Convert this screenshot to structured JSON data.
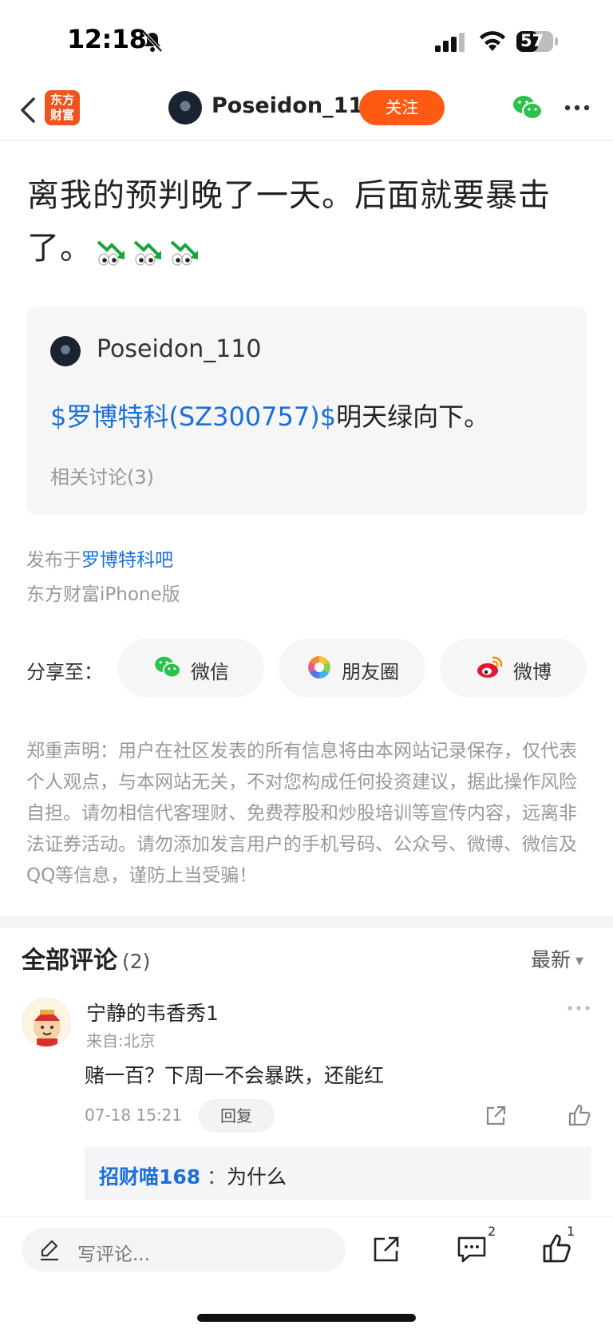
{
  "status_bar": {
    "time": "12:18",
    "battery": "57"
  },
  "nav": {
    "back_icon": "chevron-left-icon",
    "app_logo_line1": "东方",
    "app_logo_line2": "财富",
    "username": "Poseidon_110",
    "follow_label": "关注",
    "share_icon": "wechat-icon",
    "more_icon": "more-dots-icon"
  },
  "post": {
    "text": "离我的预判晚了一天。后面就要暴击了。",
    "emojis": [
      "eyes-chart-down-emoji",
      "eyes-chart-down-emoji",
      "eyes-chart-down-emoji"
    ],
    "quote": {
      "username": "Poseidon_110",
      "stock_link": "$罗博特科(SZ300757)$",
      "text": "明天绿向下。",
      "related": "相关讨论(3)"
    },
    "posted_in_prefix": "发布于",
    "posted_in_bar": "罗博特科吧",
    "device": "东方财富iPhone版"
  },
  "share": {
    "label": "分享至：",
    "targets": [
      {
        "label": "微信",
        "icon": "wechat-icon"
      },
      {
        "label": "朋友圈",
        "icon": "moments-icon"
      },
      {
        "label": "微博",
        "icon": "weibo-icon"
      }
    ]
  },
  "disclaimer": "郑重声明：用户在社区发表的所有信息将由本网站记录保存，仅代表个人观点，与本网站无关，不对您构成任何投资建议，据此操作风险自担。请勿相信代客理财、免费荐股和炒股培训等宣传内容，远离非法证券活动。请勿添加发言用户的手机号码、公众号、微博、微信及QQ等信息，谨防上当受骗！",
  "comments": {
    "title": "全部评论",
    "count": "(2)",
    "sort_label": "最新",
    "items": [
      {
        "user": "宁静的韦香秀1",
        "location": "来自:北京",
        "text": "赌一百？下周一不会暴跌，还能红",
        "time": "07-18 15:21",
        "reply_label": "回复",
        "replies": [
          {
            "user": "招财喵168",
            "colon": "：",
            "text": "为什么"
          }
        ]
      }
    ]
  },
  "bottom_bar": {
    "input_placeholder": "写评论...",
    "comment_count": "2",
    "like_count": "1"
  },
  "colors": {
    "accent": "#ff5a14",
    "link": "#1a6fd9",
    "muted": "#999999"
  }
}
